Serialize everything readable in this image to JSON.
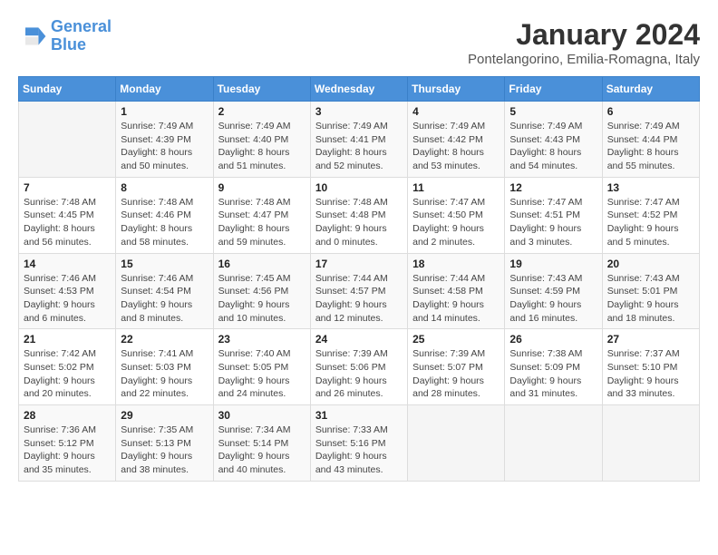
{
  "header": {
    "logo_line1": "General",
    "logo_line2": "Blue",
    "month_year": "January 2024",
    "location": "Pontelangorino, Emilia-Romagna, Italy"
  },
  "days_of_week": [
    "Sunday",
    "Monday",
    "Tuesday",
    "Wednesday",
    "Thursday",
    "Friday",
    "Saturday"
  ],
  "weeks": [
    [
      {
        "day": "",
        "sunrise": "",
        "sunset": "",
        "daylight": ""
      },
      {
        "day": "1",
        "sunrise": "Sunrise: 7:49 AM",
        "sunset": "Sunset: 4:39 PM",
        "daylight": "Daylight: 8 hours and 50 minutes."
      },
      {
        "day": "2",
        "sunrise": "Sunrise: 7:49 AM",
        "sunset": "Sunset: 4:40 PM",
        "daylight": "Daylight: 8 hours and 51 minutes."
      },
      {
        "day": "3",
        "sunrise": "Sunrise: 7:49 AM",
        "sunset": "Sunset: 4:41 PM",
        "daylight": "Daylight: 8 hours and 52 minutes."
      },
      {
        "day": "4",
        "sunrise": "Sunrise: 7:49 AM",
        "sunset": "Sunset: 4:42 PM",
        "daylight": "Daylight: 8 hours and 53 minutes."
      },
      {
        "day": "5",
        "sunrise": "Sunrise: 7:49 AM",
        "sunset": "Sunset: 4:43 PM",
        "daylight": "Daylight: 8 hours and 54 minutes."
      },
      {
        "day": "6",
        "sunrise": "Sunrise: 7:49 AM",
        "sunset": "Sunset: 4:44 PM",
        "daylight": "Daylight: 8 hours and 55 minutes."
      }
    ],
    [
      {
        "day": "7",
        "sunrise": "Sunrise: 7:48 AM",
        "sunset": "Sunset: 4:45 PM",
        "daylight": "Daylight: 8 hours and 56 minutes."
      },
      {
        "day": "8",
        "sunrise": "Sunrise: 7:48 AM",
        "sunset": "Sunset: 4:46 PM",
        "daylight": "Daylight: 8 hours and 58 minutes."
      },
      {
        "day": "9",
        "sunrise": "Sunrise: 7:48 AM",
        "sunset": "Sunset: 4:47 PM",
        "daylight": "Daylight: 8 hours and 59 minutes."
      },
      {
        "day": "10",
        "sunrise": "Sunrise: 7:48 AM",
        "sunset": "Sunset: 4:48 PM",
        "daylight": "Daylight: 9 hours and 0 minutes."
      },
      {
        "day": "11",
        "sunrise": "Sunrise: 7:47 AM",
        "sunset": "Sunset: 4:50 PM",
        "daylight": "Daylight: 9 hours and 2 minutes."
      },
      {
        "day": "12",
        "sunrise": "Sunrise: 7:47 AM",
        "sunset": "Sunset: 4:51 PM",
        "daylight": "Daylight: 9 hours and 3 minutes."
      },
      {
        "day": "13",
        "sunrise": "Sunrise: 7:47 AM",
        "sunset": "Sunset: 4:52 PM",
        "daylight": "Daylight: 9 hours and 5 minutes."
      }
    ],
    [
      {
        "day": "14",
        "sunrise": "Sunrise: 7:46 AM",
        "sunset": "Sunset: 4:53 PM",
        "daylight": "Daylight: 9 hours and 6 minutes."
      },
      {
        "day": "15",
        "sunrise": "Sunrise: 7:46 AM",
        "sunset": "Sunset: 4:54 PM",
        "daylight": "Daylight: 9 hours and 8 minutes."
      },
      {
        "day": "16",
        "sunrise": "Sunrise: 7:45 AM",
        "sunset": "Sunset: 4:56 PM",
        "daylight": "Daylight: 9 hours and 10 minutes."
      },
      {
        "day": "17",
        "sunrise": "Sunrise: 7:44 AM",
        "sunset": "Sunset: 4:57 PM",
        "daylight": "Daylight: 9 hours and 12 minutes."
      },
      {
        "day": "18",
        "sunrise": "Sunrise: 7:44 AM",
        "sunset": "Sunset: 4:58 PM",
        "daylight": "Daylight: 9 hours and 14 minutes."
      },
      {
        "day": "19",
        "sunrise": "Sunrise: 7:43 AM",
        "sunset": "Sunset: 4:59 PM",
        "daylight": "Daylight: 9 hours and 16 minutes."
      },
      {
        "day": "20",
        "sunrise": "Sunrise: 7:43 AM",
        "sunset": "Sunset: 5:01 PM",
        "daylight": "Daylight: 9 hours and 18 minutes."
      }
    ],
    [
      {
        "day": "21",
        "sunrise": "Sunrise: 7:42 AM",
        "sunset": "Sunset: 5:02 PM",
        "daylight": "Daylight: 9 hours and 20 minutes."
      },
      {
        "day": "22",
        "sunrise": "Sunrise: 7:41 AM",
        "sunset": "Sunset: 5:03 PM",
        "daylight": "Daylight: 9 hours and 22 minutes."
      },
      {
        "day": "23",
        "sunrise": "Sunrise: 7:40 AM",
        "sunset": "Sunset: 5:05 PM",
        "daylight": "Daylight: 9 hours and 24 minutes."
      },
      {
        "day": "24",
        "sunrise": "Sunrise: 7:39 AM",
        "sunset": "Sunset: 5:06 PM",
        "daylight": "Daylight: 9 hours and 26 minutes."
      },
      {
        "day": "25",
        "sunrise": "Sunrise: 7:39 AM",
        "sunset": "Sunset: 5:07 PM",
        "daylight": "Daylight: 9 hours and 28 minutes."
      },
      {
        "day": "26",
        "sunrise": "Sunrise: 7:38 AM",
        "sunset": "Sunset: 5:09 PM",
        "daylight": "Daylight: 9 hours and 31 minutes."
      },
      {
        "day": "27",
        "sunrise": "Sunrise: 7:37 AM",
        "sunset": "Sunset: 5:10 PM",
        "daylight": "Daylight: 9 hours and 33 minutes."
      }
    ],
    [
      {
        "day": "28",
        "sunrise": "Sunrise: 7:36 AM",
        "sunset": "Sunset: 5:12 PM",
        "daylight": "Daylight: 9 hours and 35 minutes."
      },
      {
        "day": "29",
        "sunrise": "Sunrise: 7:35 AM",
        "sunset": "Sunset: 5:13 PM",
        "daylight": "Daylight: 9 hours and 38 minutes."
      },
      {
        "day": "30",
        "sunrise": "Sunrise: 7:34 AM",
        "sunset": "Sunset: 5:14 PM",
        "daylight": "Daylight: 9 hours and 40 minutes."
      },
      {
        "day": "31",
        "sunrise": "Sunrise: 7:33 AM",
        "sunset": "Sunset: 5:16 PM",
        "daylight": "Daylight: 9 hours and 43 minutes."
      },
      {
        "day": "",
        "sunrise": "",
        "sunset": "",
        "daylight": ""
      },
      {
        "day": "",
        "sunrise": "",
        "sunset": "",
        "daylight": ""
      },
      {
        "day": "",
        "sunrise": "",
        "sunset": "",
        "daylight": ""
      }
    ]
  ]
}
